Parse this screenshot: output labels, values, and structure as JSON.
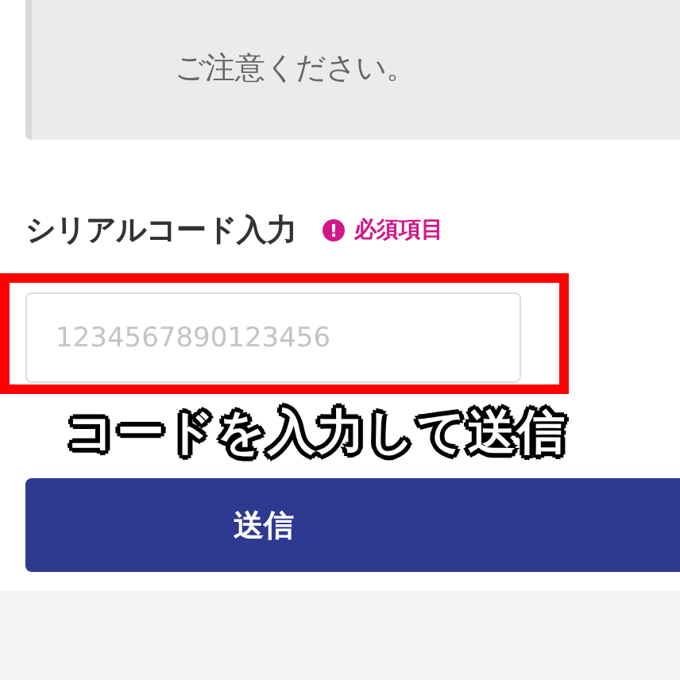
{
  "notice": {
    "text": "ご注意ください。"
  },
  "serial_field": {
    "label": "シリアルコード入力",
    "required_badge": "必須項目",
    "required_icon": "!",
    "placeholder": "1234567890123456",
    "highlighted": true
  },
  "caption": "コードを入力して送信",
  "submit_button": {
    "label": "送信"
  }
}
